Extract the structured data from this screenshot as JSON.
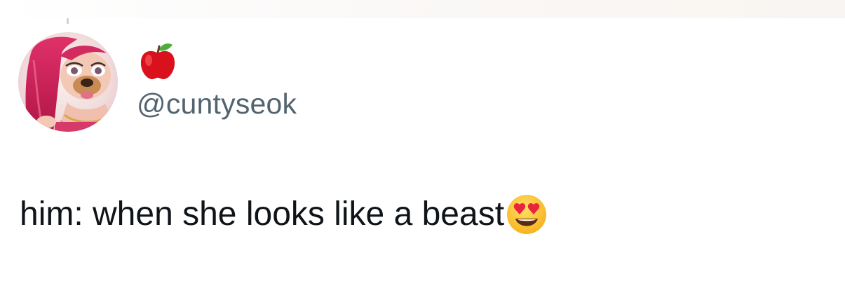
{
  "tweet": {
    "author": {
      "display_name_icon": "red-apple-emoji",
      "handle": "@cuntyseok",
      "avatar_icon": "profile-avatar"
    },
    "text": "him: when she looks like a beast",
    "text_emoji": "heart-eyes-emoji"
  },
  "colors": {
    "text_primary": "#0f1419",
    "text_secondary": "#536471",
    "background": "#ffffff"
  }
}
